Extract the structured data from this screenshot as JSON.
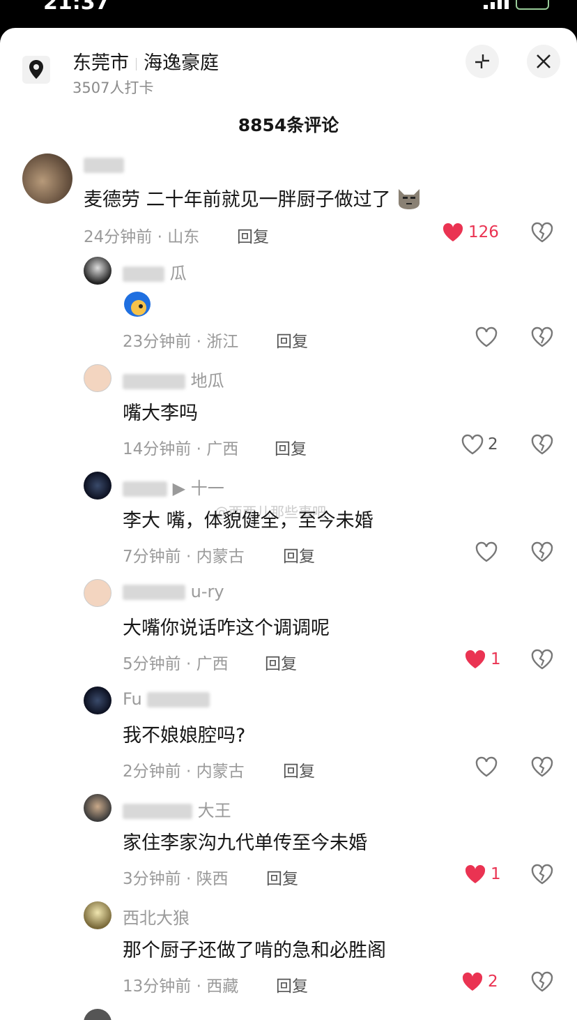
{
  "status_bar": {
    "time": "21:37"
  },
  "header": {
    "city": "东莞市",
    "place": "海逸豪庭",
    "checkins": "3507人打卡",
    "location_icon": "map-pin-icon",
    "collapse_icon": "collapse-icon",
    "close_icon": "close-icon"
  },
  "comment_count": "8854条评论",
  "watermark": "@西西儿那些事吧",
  "comments": [
    {
      "user_visible": "",
      "text": "麦德劳 二十年前就见一胖厨子做过了",
      "time": "24分钟前 · 山东",
      "reply": "回复",
      "likes": "126",
      "liked": true,
      "emoji": "cat-face-emoji"
    },
    {
      "user_visible": "瓜",
      "text": "",
      "time": "23分钟前 · 浙江",
      "reply": "回复",
      "likes": "",
      "liked": false,
      "emoji": "blue-hair-face-emoji"
    },
    {
      "user_visible": "地瓜",
      "text": "嘴大李吗",
      "time": "14分钟前 · 广西",
      "reply": "回复",
      "likes": "2",
      "liked": false
    },
    {
      "user_visible": "十一",
      "text": "李大  嘴，体貌健全，至今未婚",
      "time": "7分钟前 · 内蒙古",
      "reply": "回复",
      "likes": "",
      "liked": false
    },
    {
      "user_visible": "u-ry",
      "text": "大嘴你说话咋这个调调呢",
      "time": "5分钟前 · 广西",
      "reply": "回复",
      "likes": "1",
      "liked": true
    },
    {
      "user_visible": "Fu",
      "text": "我不娘娘腔吗?",
      "time": "2分钟前 · 内蒙古",
      "reply": "回复",
      "likes": "",
      "liked": false
    },
    {
      "user_visible": "大王",
      "text": "家住李家沟九代单传至今未婚",
      "time": "3分钟前 · 陕西",
      "reply": "回复",
      "likes": "1",
      "liked": true
    },
    {
      "user_visible": "西北大狼",
      "text": "那个厨子还做了啃的急和必胜阁",
      "time": "13分钟前 · 西藏",
      "reply": "回复",
      "likes": "2",
      "liked": true
    }
  ]
}
